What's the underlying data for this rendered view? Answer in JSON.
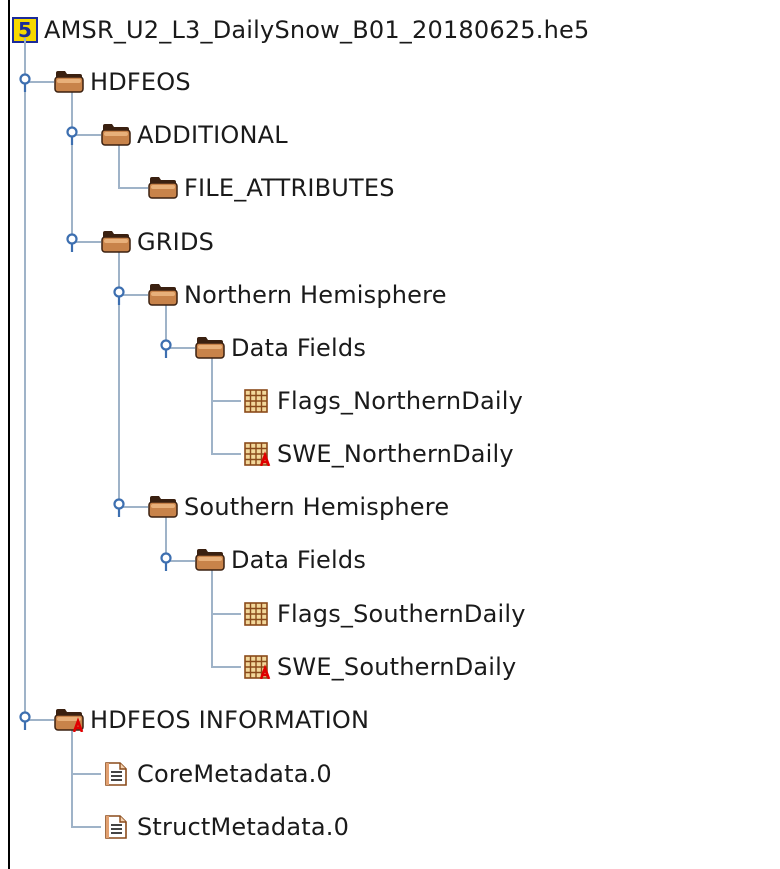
{
  "window": {
    "title": "AMSR_U2_L3_DailySnow_B01_20180625.he5"
  },
  "icons": {
    "root": "hdf5-file-icon",
    "group": "folder-icon",
    "group_with_attributes": "folder-attribute-icon",
    "dataset": "grid-dataset-icon",
    "dataset_with_attributes": "grid-dataset-attribute-icon",
    "text_dataset": "text-document-icon"
  },
  "tree": {
    "root_label": "AMSR_U2_L3_DailySnow_B01_20180625.he5",
    "root_badge": "5",
    "nodes": [
      {
        "label": "HDFEOS",
        "icon": "folder-icon"
      },
      {
        "label": "ADDITIONAL",
        "icon": "folder-icon"
      },
      {
        "label": "FILE_ATTRIBUTES",
        "icon": "folder-icon"
      },
      {
        "label": "GRIDS",
        "icon": "folder-icon"
      },
      {
        "label": "Northern Hemisphere",
        "icon": "folder-icon"
      },
      {
        "label": "Data Fields",
        "icon": "folder-icon"
      },
      {
        "label": "Flags_NorthernDaily",
        "icon": "grid-dataset-icon"
      },
      {
        "label": "SWE_NorthernDaily",
        "icon": "grid-dataset-attribute-icon"
      },
      {
        "label": "Southern Hemisphere",
        "icon": "folder-icon"
      },
      {
        "label": "Data Fields",
        "icon": "folder-icon"
      },
      {
        "label": "Flags_SouthernDaily",
        "icon": "grid-dataset-icon"
      },
      {
        "label": "SWE_SouthernDaily",
        "icon": "grid-dataset-attribute-icon"
      },
      {
        "label": "HDFEOS INFORMATION",
        "icon": "folder-attribute-icon"
      },
      {
        "label": "CoreMetadata.0",
        "icon": "text-document-icon"
      },
      {
        "label": "StructMetadata.0",
        "icon": "text-document-icon"
      }
    ]
  },
  "colors": {
    "tree_line": "#9fb3c8",
    "toggle": "#3d6fb0",
    "folder_body": "#c8834a",
    "folder_dark": "#3a2010",
    "attribute_marker": "#e00000",
    "badge_fill": "#f6d800",
    "badge_border": "#1b2b9a"
  }
}
